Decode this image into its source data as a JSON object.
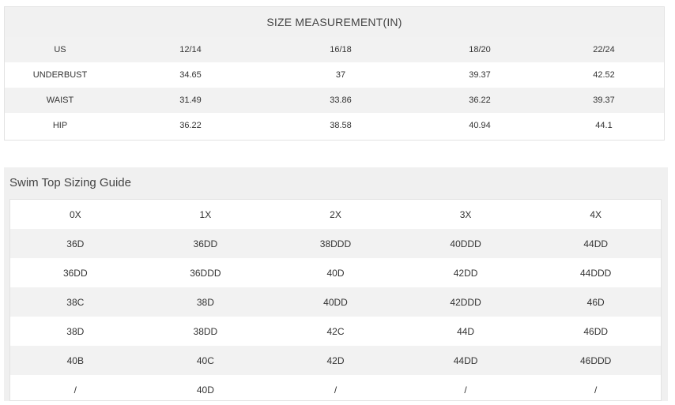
{
  "size_measurement": {
    "title": "SIZE MEASUREMENT(IN)",
    "rows": [
      [
        "US",
        "12/14",
        "16/18",
        "18/20",
        "22/24"
      ],
      [
        "UNDERBUST",
        "34.65",
        "37",
        "39.37",
        "42.52"
      ],
      [
        "WAIST",
        "31.49",
        "33.86",
        "36.22",
        "39.37"
      ],
      [
        "HIP",
        "36.22",
        "38.58",
        "40.94",
        "44.1"
      ]
    ]
  },
  "swim_top_guide": {
    "title": "Swim Top Sizing Guide",
    "rows": [
      [
        "0X",
        "1X",
        "2X",
        "3X",
        "4X"
      ],
      [
        "36D",
        "36DD",
        "38DDD",
        "40DDD",
        "44DD"
      ],
      [
        "36DD",
        "36DDD",
        "40D",
        "42DD",
        "44DDD"
      ],
      [
        "38C",
        "38D",
        "40DD",
        "42DDD",
        "46D"
      ],
      [
        "38D",
        "38DD",
        "42C",
        "44D",
        "46DD"
      ],
      [
        "40B",
        "40C",
        "42D",
        "44DD",
        "46DDD"
      ],
      [
        "/",
        "40D",
        "/",
        "/",
        "/"
      ]
    ]
  }
}
